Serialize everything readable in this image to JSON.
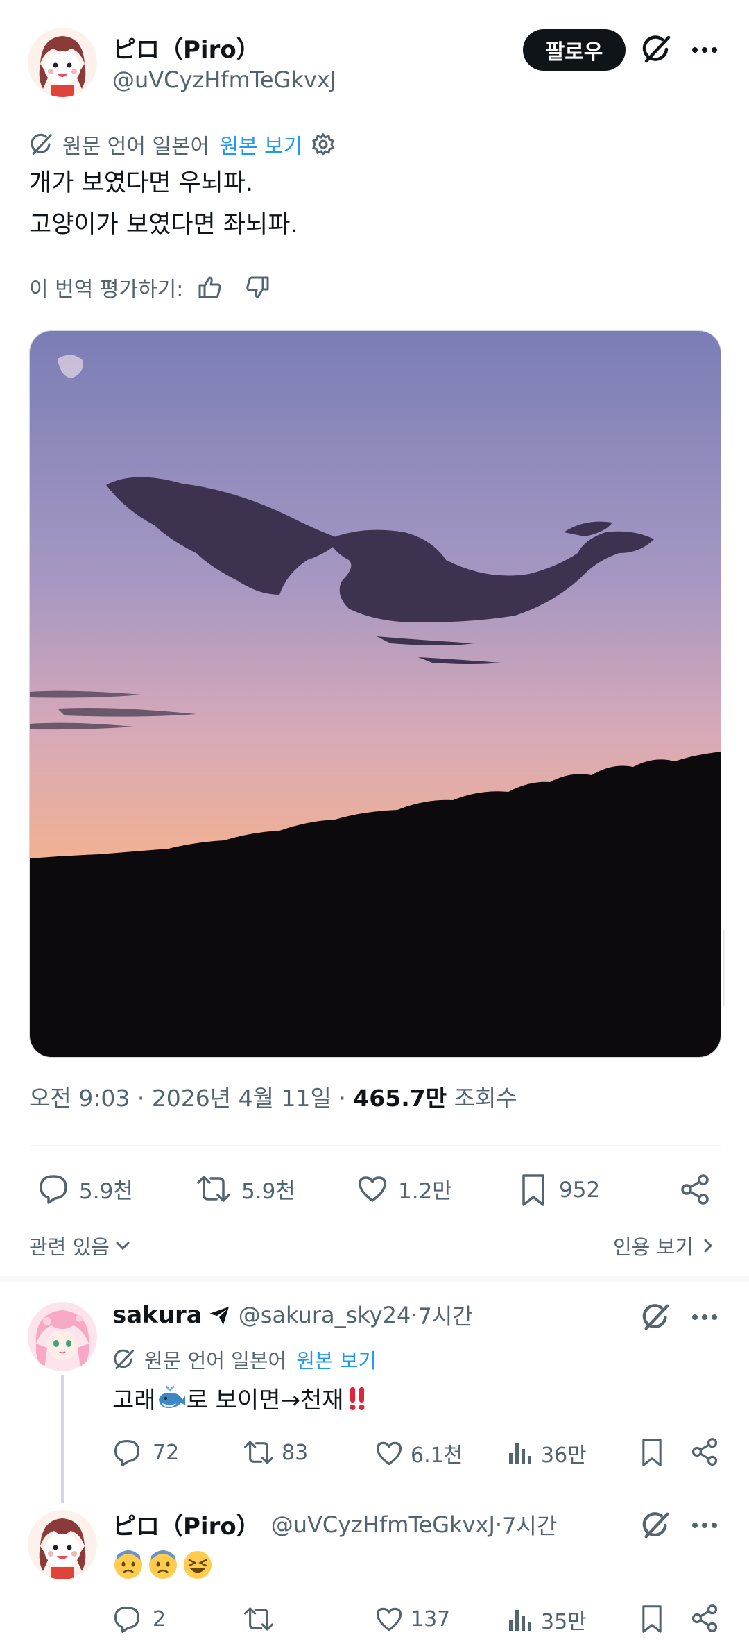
{
  "post": {
    "author": {
      "display_name": "ピロ（Piro）",
      "handle": "@uVCyzHfmTeGkvxJ"
    },
    "follow_label": "팔로우",
    "translation": {
      "notice": "원문 언어 일본어",
      "show_original": "원본 보기"
    },
    "text_lines": [
      "개가 보였다면 우뇌파.",
      "고양이가 보였다면 좌뇌파."
    ],
    "rate_translation": "이 번역 평가하기:",
    "meta": {
      "time": "오전 9:03",
      "date": "2026년 4월 11일",
      "views": "465.7만",
      "views_label": "조회수"
    },
    "actions": {
      "replies": "5.9천",
      "reposts": "5.9천",
      "likes": "1.2만",
      "bookmarks": "952"
    },
    "related_label": "관련 있음",
    "quotes_label": "인용 보기"
  },
  "replies": [
    {
      "display_name": "sakura",
      "handle": "@sakura_sky24",
      "time": "7시간",
      "translation": {
        "notice": "원문 언어 일본어",
        "show_original": "원본 보기"
      },
      "text_a": "고래",
      "text_b": "로 보이면→천재",
      "emoji": [
        "spouting-whale",
        "double-exclamation"
      ],
      "stats": {
        "replies": "72",
        "reposts": "83",
        "likes": "6.1천",
        "views": "36만"
      }
    },
    {
      "display_name": "ピロ（Piro）",
      "handle": "@uVCyzHfmTeGkvxJ",
      "time": "7시간",
      "emoji": [
        "anxious-face",
        "anxious-face",
        "laughing-face"
      ],
      "stats": {
        "replies": "2",
        "reposts": "",
        "likes": "137",
        "views": "35만"
      }
    }
  ],
  "colors": {
    "text": "#0f1419",
    "secondary": "#536471",
    "link": "#1d9bf0",
    "follow_bg": "#0f1419"
  }
}
